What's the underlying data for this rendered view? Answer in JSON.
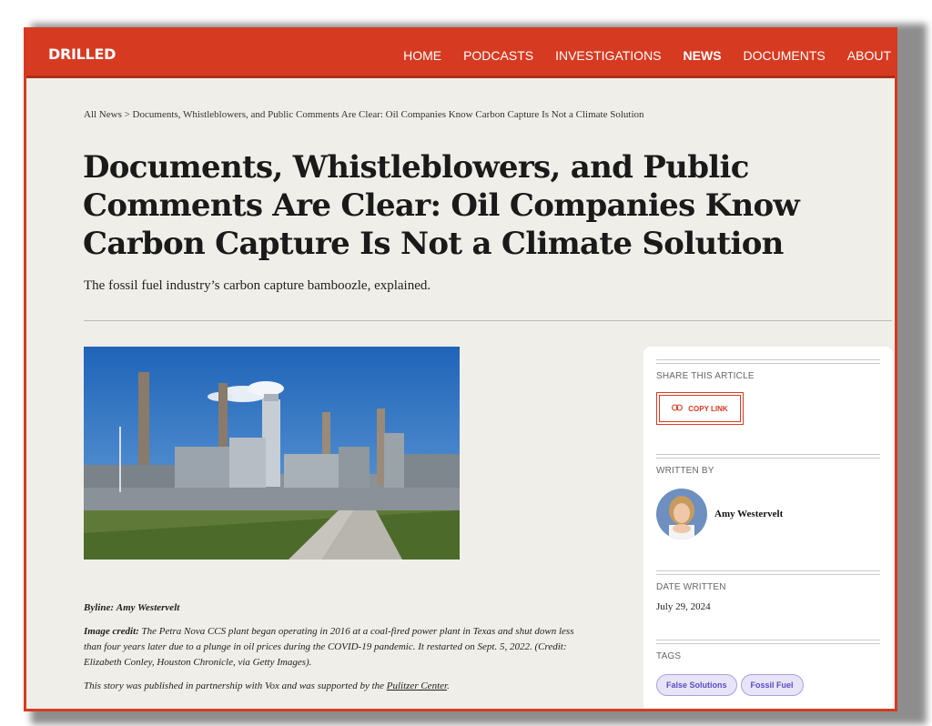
{
  "site": {
    "logo": "DRILLED"
  },
  "nav": {
    "items": [
      "HOME",
      "PODCASTS",
      "INVESTIGATIONS",
      "NEWS",
      "DOCUMENTS",
      "ABOUT"
    ],
    "active": "NEWS"
  },
  "breadcrumb": "All News > Documents, Whistleblowers, and Public Comments Are Clear: Oil Companies Know Carbon Capture Is Not a Climate Solution",
  "article": {
    "title": "Documents, Whistleblowers, and Public Comments Are Clear: Oil Companies Know Carbon Capture Is Not a Climate Solution",
    "subtitle": "The fossil fuel industry’s carbon capture bamboozle, explained.",
    "byline_label": "Byline:",
    "byline_value": "Amy Westervelt",
    "image_credit_label": "Image credit:",
    "image_credit_text": "The Petra Nova CCS plant began operating in 2016 at a coal-fired power plant in Texas and shut down less than four years later due to a plunge in oil prices during the COVID-19 pandemic. It restarted on Sept. 5, 2022. (Credit: Elizabeth Conley, Houston Chronicle, via Getty Images).",
    "partnership_text": "This story was published in partnership with Vox and was supported by the",
    "partnership_link": "Pulitzer Center",
    "partnership_end": "."
  },
  "sidebar": {
    "share_label": "SHARE THIS ARTICLE",
    "copy_link_label": "COPY LINK",
    "written_by_label": "WRITTEN BY",
    "author_name": "Amy Westervelt",
    "date_label": "DATE WRITTEN",
    "date_value": "July 29, 2024",
    "tags_label": "TAGS",
    "tags": [
      "False Solutions",
      "Fossil Fuel"
    ]
  },
  "colors": {
    "brand": "#d63b22",
    "background": "#efeee8",
    "tag": "#5b4cc4"
  },
  "icons": {
    "copy": "link-icon"
  }
}
